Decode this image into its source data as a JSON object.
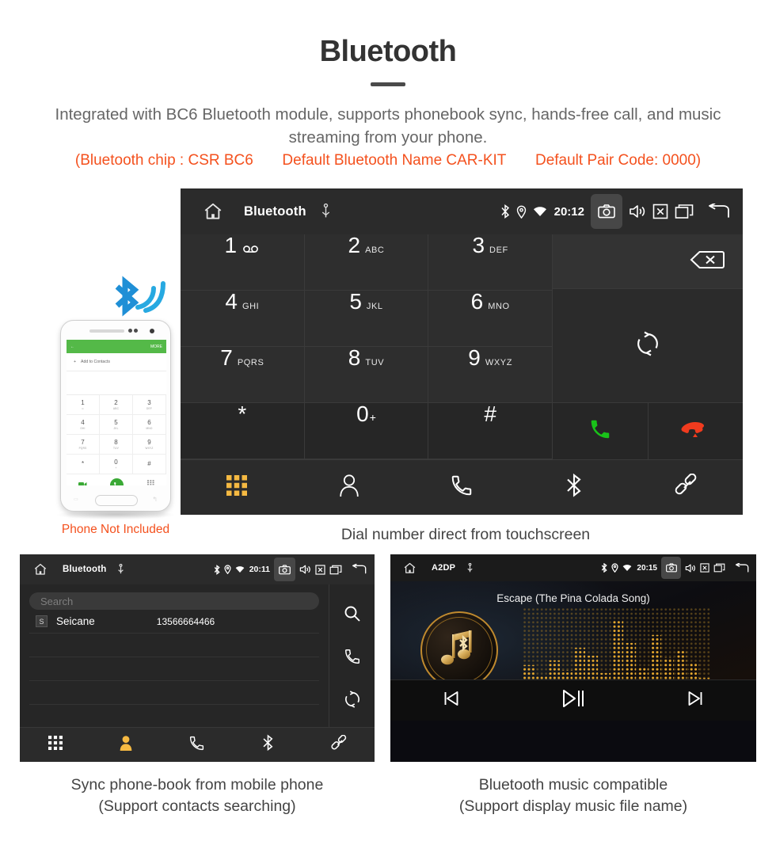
{
  "header": {
    "title": "Bluetooth",
    "subtitle": "Integrated with BC6 Bluetooth module, supports phonebook sync, hands-free call, and music streaming from your phone.",
    "spec_chip": "(Bluetooth chip : CSR BC6",
    "spec_name": "Default Bluetooth Name CAR-KIT",
    "spec_pair": "Default Pair Code: 0000)",
    "accent_red": "#f4511e",
    "text_gray": "#666666"
  },
  "dial_screen": {
    "status": {
      "title": "Bluetooth",
      "time": "20:12",
      "icons": [
        "home-icon",
        "usb-icon",
        "bluetooth-icon",
        "location-icon",
        "wifi-icon",
        "camera-icon",
        "volume-icon",
        "close-box-icon",
        "recents-icon",
        "back-icon"
      ]
    },
    "keys": [
      {
        "num": "1",
        "sub": "",
        "voicemail": true
      },
      {
        "num": "2",
        "sub": "ABC"
      },
      {
        "num": "3",
        "sub": "DEF"
      },
      {
        "num": "4",
        "sub": "GHI"
      },
      {
        "num": "5",
        "sub": "JKL"
      },
      {
        "num": "6",
        "sub": "MNO"
      },
      {
        "num": "7",
        "sub": "PQRS"
      },
      {
        "num": "8",
        "sub": "TUV"
      },
      {
        "num": "9",
        "sub": "WXYZ"
      },
      {
        "num": "*",
        "sub": ""
      },
      {
        "num": "0",
        "sub": "",
        "plus": "+"
      },
      {
        "num": "#",
        "sub": ""
      }
    ],
    "side": {
      "backspace": "backspace-icon",
      "sync": "sync-icon",
      "call": "call-icon",
      "hangup": "hangup-icon",
      "call_color": "#19c219",
      "hangup_color": "#f03b1e"
    },
    "nav": [
      "keypad-icon",
      "contacts-icon",
      "calls-icon",
      "bluetooth-icon",
      "link-icon"
    ],
    "nav_active_index": 0,
    "nav_active_color": "#f5b942",
    "caption": "Dial number direct from touchscreen"
  },
  "phone_illustration": {
    "app_more": "MORE",
    "add_contacts": "Add to Contacts",
    "keys": [
      {
        "num": "1",
        "sub": "∞"
      },
      {
        "num": "2",
        "sub": "ABC"
      },
      {
        "num": "3",
        "sub": "DEF"
      },
      {
        "num": "4",
        "sub": "GHI"
      },
      {
        "num": "5",
        "sub": "JKL"
      },
      {
        "num": "6",
        "sub": "MNO"
      },
      {
        "num": "7",
        "sub": "PQRS"
      },
      {
        "num": "8",
        "sub": "TUV"
      },
      {
        "num": "9",
        "sub": "WXYZ"
      },
      {
        "num": "*",
        "sub": ""
      },
      {
        "num": "0",
        "sub": "+"
      },
      {
        "num": "#",
        "sub": ""
      }
    ],
    "note": "Phone Not Included",
    "note_color": "#f4511e",
    "app_bar_color": "#54b948"
  },
  "phonebook_screen": {
    "status": {
      "title": "Bluetooth",
      "time": "20:11"
    },
    "search_placeholder": "Search",
    "contacts": [
      {
        "initial": "S",
        "name": "Seicane",
        "number": "13566664466"
      }
    ],
    "actions": [
      "search-icon",
      "call-icon",
      "sync-icon"
    ],
    "nav": [
      "keypad-icon",
      "contacts-icon",
      "calls-icon",
      "bluetooth-icon",
      "link-icon"
    ],
    "nav_active_index": 1,
    "caption_line1": "Sync phone-book from mobile phone",
    "caption_line2": "(Support contacts searching)"
  },
  "music_screen": {
    "status": {
      "title": "A2DP",
      "time": "20:15"
    },
    "song_title": "Escape (The Pina Colada Song)",
    "controls": [
      "previous-icon",
      "play-pause-icon",
      "next-icon"
    ],
    "accent_gold": "#c08a2e",
    "caption_line1": "Bluetooth music compatible",
    "caption_line2": "(Support display music file name)"
  }
}
